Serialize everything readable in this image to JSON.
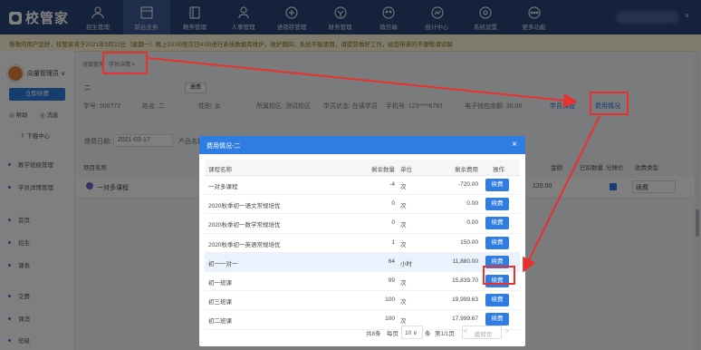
{
  "header": {
    "logo": "校管家",
    "tabs": [
      {
        "label": "招生管理",
        "icon": "person-icon"
      },
      {
        "label": "前台业务",
        "icon": "desk-icon"
      },
      {
        "label": "教务管理",
        "icon": "book-icon"
      },
      {
        "label": "人事管理",
        "icon": "staff-icon"
      },
      {
        "label": "进销存管理",
        "icon": "inventory-icon"
      },
      {
        "label": "财务管理",
        "icon": "finance-icon"
      },
      {
        "label": "微信端",
        "icon": "wechat-icon"
      },
      {
        "label": "统计中心",
        "icon": "stats-icon"
      },
      {
        "label": "系统设置",
        "icon": "settings-icon"
      },
      {
        "label": "更多功能",
        "icon": "more-icon"
      }
    ],
    "active_tab": 1
  },
  "notice": "尊敬的用户您好，校管家将于2021年3月22日（星期一）晚上23:00至次日4:00进行系统数据库维护，维护期间，系统不能使用，请提前做好工作，给您带来的不便敬请谅解",
  "sidebar": {
    "user": "向量管理员 ∨",
    "renew_button": "立即续费",
    "link_help": "帮助",
    "link_msg": "消息",
    "download": "下载中心",
    "menu": [
      "教学班级管理",
      "学员详情管理",
      "首页",
      "招生",
      "课表",
      "交费",
      "课消",
      "班级"
    ]
  },
  "student": {
    "breadcrumb": "班级管理",
    "breadcrumb_tab": "学员详情 ×",
    "name": "二",
    "pay_button": "缴费",
    "info": {
      "id": "学号: 500772",
      "name": "姓名: 二",
      "gender": "性别: 女",
      "campus": "所属校区: 测试校区",
      "status": "学员状态: 在读学员",
      "phone": "手机号: 123****6781",
      "wallet": "电子钱包余额: 30.00"
    },
    "tab_courses": "学员课程",
    "tab_fees": "费用情况"
  },
  "filter": {
    "date_label": "缴费日期:",
    "date": "2021-03-17",
    "product_label": "产品名称"
  },
  "bg_table": {
    "headers": {
      "item": "项目名称",
      "amount": "金额",
      "deducted": "已扣数量",
      "share": "分摊价",
      "fee_type": "收费类型"
    },
    "row": {
      "item": "一对多课程",
      "amount": "120.00",
      "fee_type": "续费"
    }
  },
  "modal": {
    "title": "费用情况-二",
    "close": "×",
    "columns": {
      "name": "课程名称",
      "qty": "剩余数量",
      "unit": "单位",
      "fee": "剩余费用",
      "op": "操作"
    },
    "rows": [
      {
        "name": "一对多课程",
        "qty": "-4",
        "unit": "次",
        "fee": "-720.00"
      },
      {
        "name": "2020秋季初一语文常规培优",
        "qty": "0",
        "unit": "次",
        "fee": "0.00"
      },
      {
        "name": "2020秋季初一数学常规培优",
        "qty": "0",
        "unit": "次",
        "fee": "0.00"
      },
      {
        "name": "2020秋季初一英语常规培优",
        "qty": "1",
        "unit": "次",
        "fee": "150.00"
      },
      {
        "name": "初一一对一",
        "qty": "64",
        "unit": "小时",
        "fee": "11,880.00"
      },
      {
        "name": "初一班课",
        "qty": "99",
        "unit": "次",
        "fee": "15,839.70"
      },
      {
        "name": "初三班课",
        "qty": "100",
        "unit": "次",
        "fee": "19,999.63"
      },
      {
        "name": "初二班课",
        "qty": "100",
        "unit": "次",
        "fee": "17,999.67"
      }
    ],
    "action_label": "续费",
    "highlight_row": 4,
    "footer": {
      "total": "共8条",
      "per_page_label": "每页",
      "per_page": "10 ∨",
      "unit": "条",
      "page": "第1/1页",
      "prev": "<",
      "jump": "跳转页",
      "next": ">"
    }
  },
  "colors": {
    "header": "#2a4478",
    "primary": "#2f7de1",
    "annotation": "#e8312f",
    "notice_bg": "#fff8dc"
  }
}
